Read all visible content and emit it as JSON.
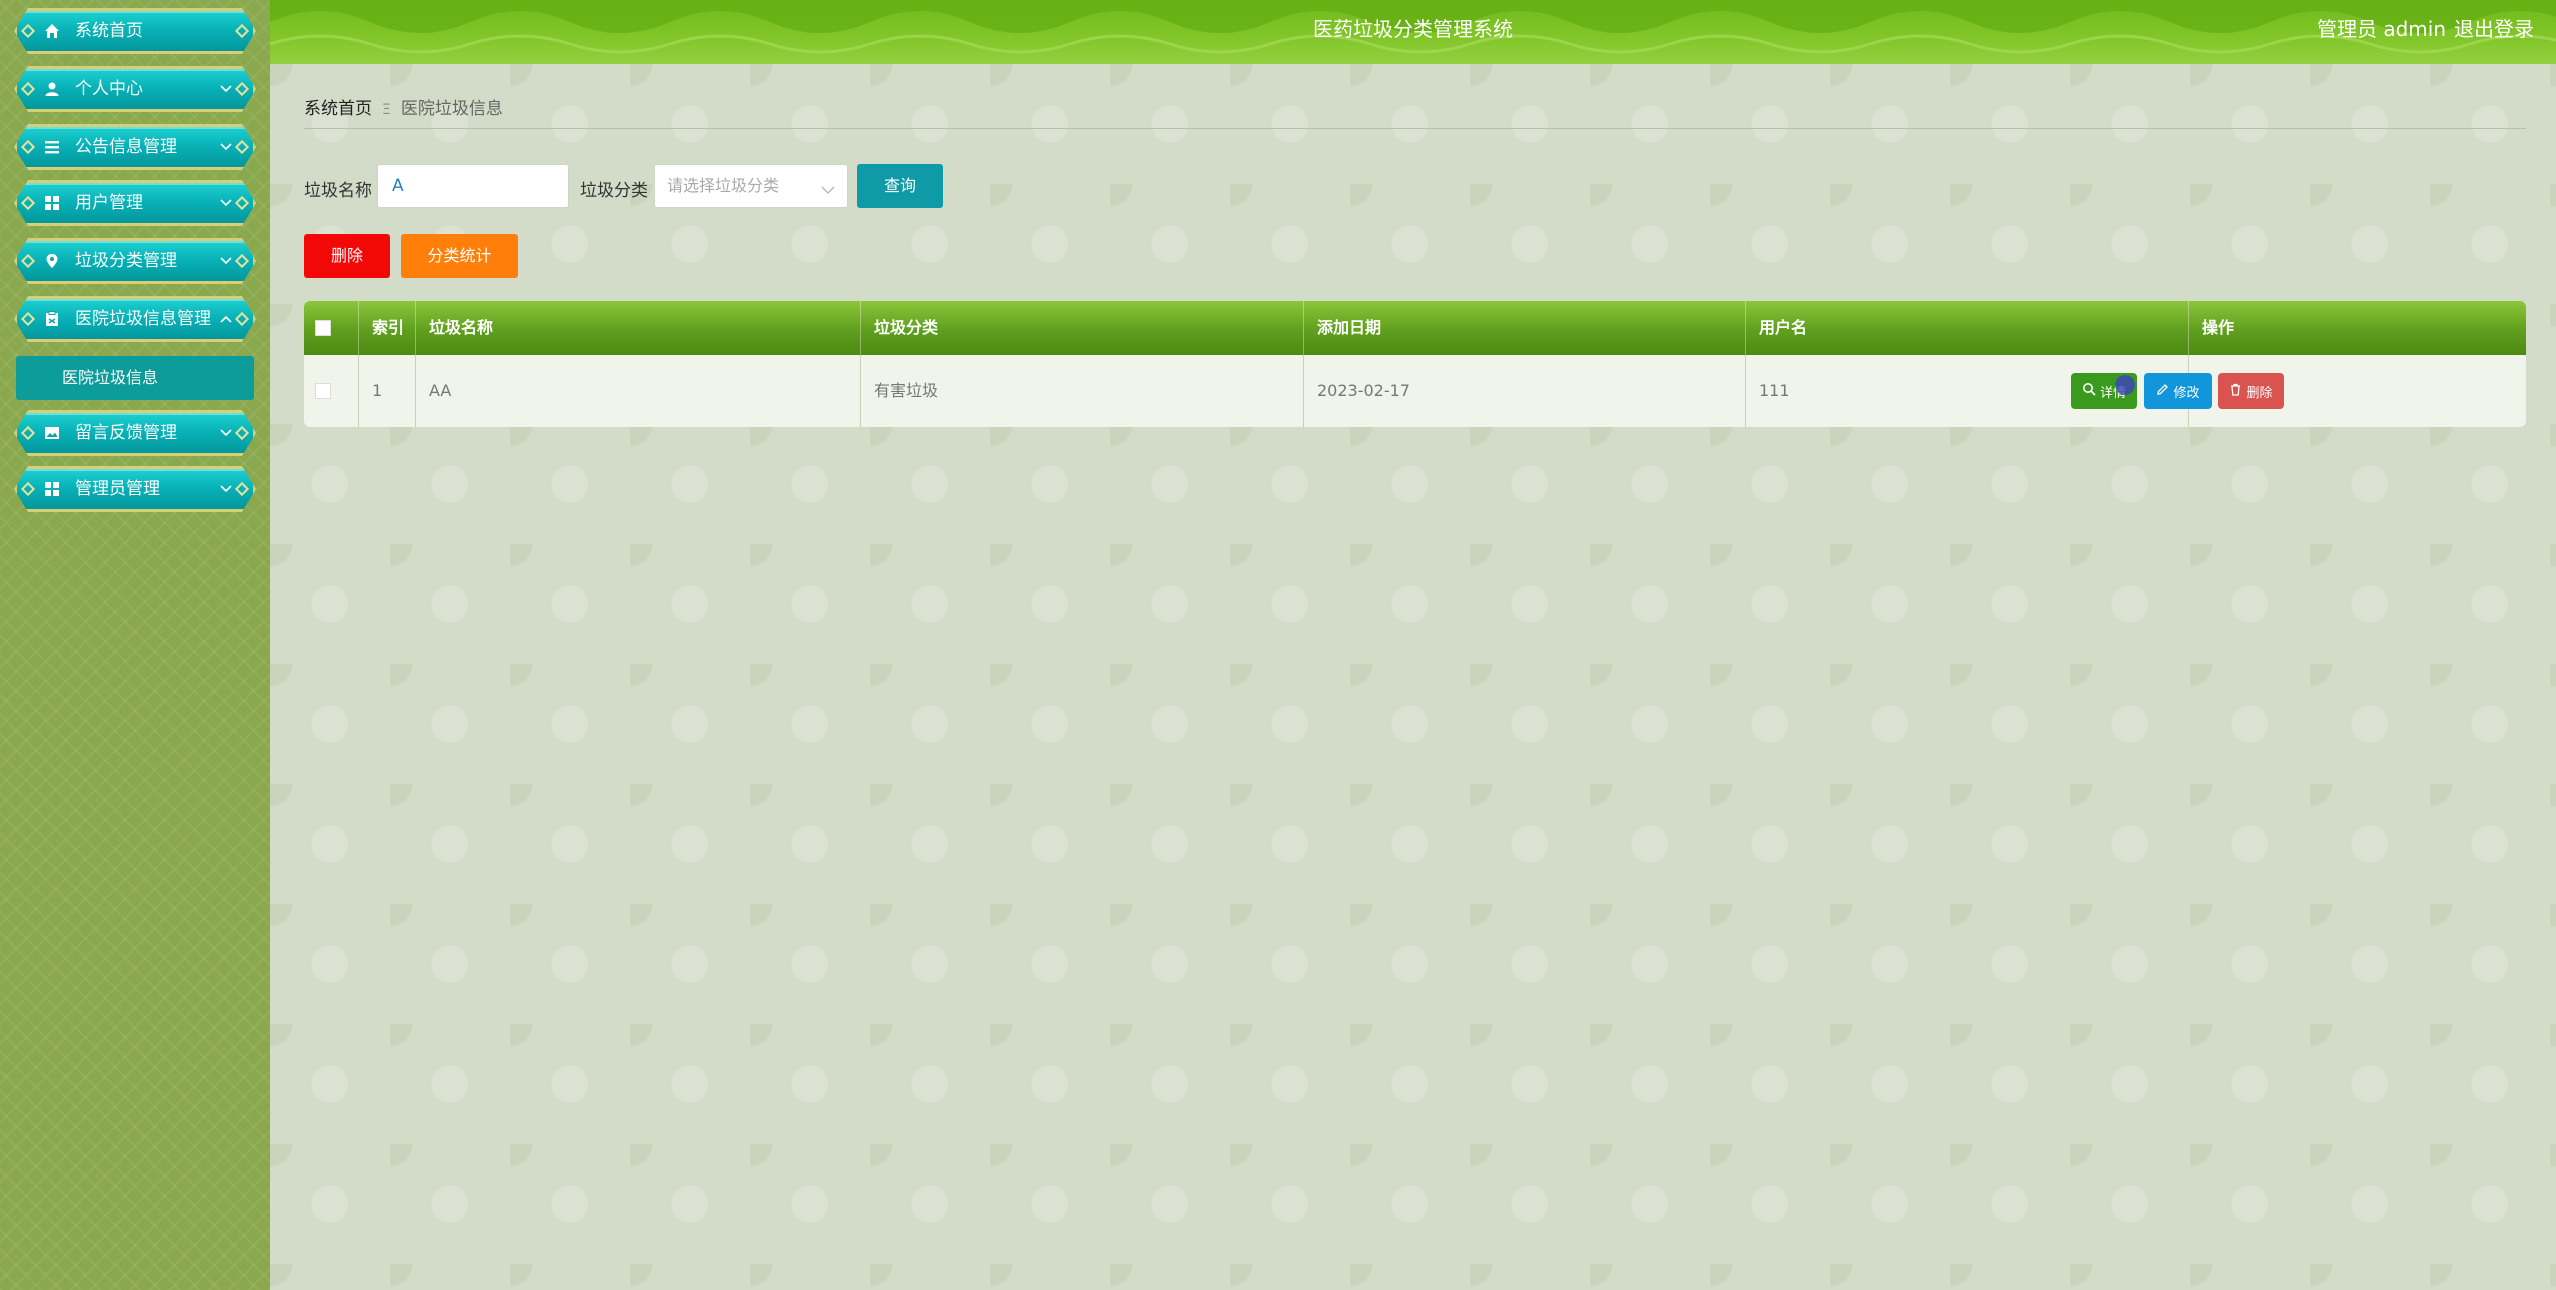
{
  "header": {
    "title": "医药垃圾分类管理系统",
    "user": "管理员 admin",
    "logout": "退出登录"
  },
  "sidebar": {
    "items": [
      {
        "label": "系统首页",
        "icon": "home-icon"
      },
      {
        "label": "个人中心",
        "icon": "user-icon"
      },
      {
        "label": "公告信息管理",
        "icon": "list-icon"
      },
      {
        "label": "用户管理",
        "icon": "grid-icon"
      },
      {
        "label": "垃圾分类管理",
        "icon": "location-icon"
      },
      {
        "label": "医院垃圾信息管理",
        "icon": "clipboard-icon"
      },
      {
        "label": "留言反馈管理",
        "icon": "image-icon"
      },
      {
        "label": "管理员管理",
        "icon": "grid-icon"
      }
    ],
    "submenu": {
      "label": "医院垃圾信息"
    }
  },
  "breadcrumb": {
    "home": "系统首页",
    "separator": "Ξ",
    "current": "医院垃圾信息"
  },
  "search": {
    "name_label": "垃圾名称",
    "name_value": "A",
    "category_label": "垃圾分类",
    "category_placeholder": "请选择垃圾分类",
    "search_button": "查询"
  },
  "actions": {
    "delete": "删除",
    "stats": "分类统计"
  },
  "table": {
    "columns": [
      "索引",
      "垃圾名称",
      "垃圾分类",
      "添加日期",
      "用户名",
      "操作"
    ],
    "rows": [
      {
        "index": "1",
        "name": "AA",
        "category": "有害垃圾",
        "date": "2023-02-17",
        "username": "111"
      }
    ],
    "row_actions": {
      "view": "详情",
      "edit": "修改",
      "delete": "删除"
    }
  },
  "colors": {
    "header_green": "#7cc023",
    "menu_teal": "#08b3b8",
    "delete_red": "#f30808",
    "stats_orange": "#ff7f0a",
    "search_teal": "#0e9aa7"
  }
}
